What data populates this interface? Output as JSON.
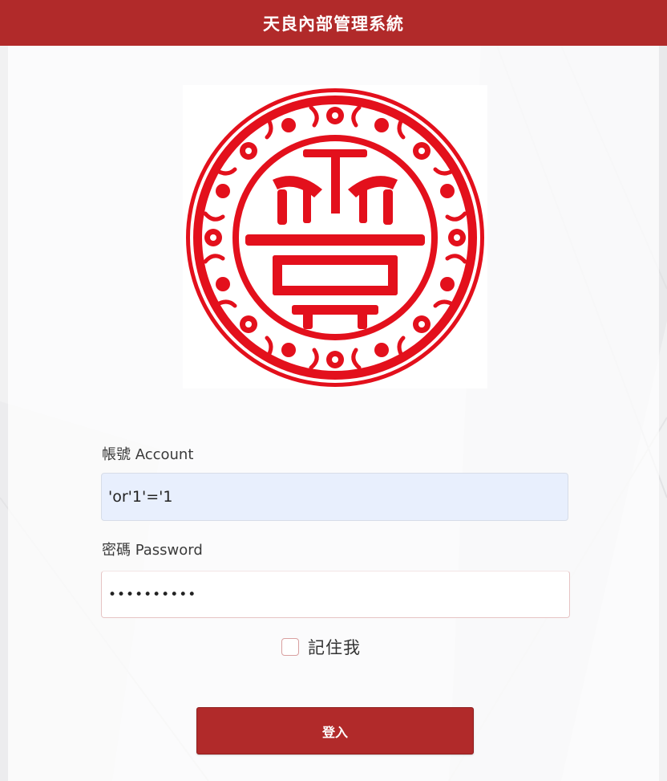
{
  "header": {
    "title": "天良內部管理系統"
  },
  "logo": {
    "name": "seal-logo",
    "color": "#e3101c"
  },
  "form": {
    "account_label": "帳號 Account",
    "account_value": "'or'1'='1",
    "password_label": "密碼 Password",
    "password_value": "••••••••••",
    "remember_label": "記住我",
    "remember_checked": false,
    "login_label": "登入"
  },
  "colors": {
    "header_bg": "#b12a2a",
    "button_bg": "#b12a2a",
    "autofill_bg": "#e8effd"
  }
}
